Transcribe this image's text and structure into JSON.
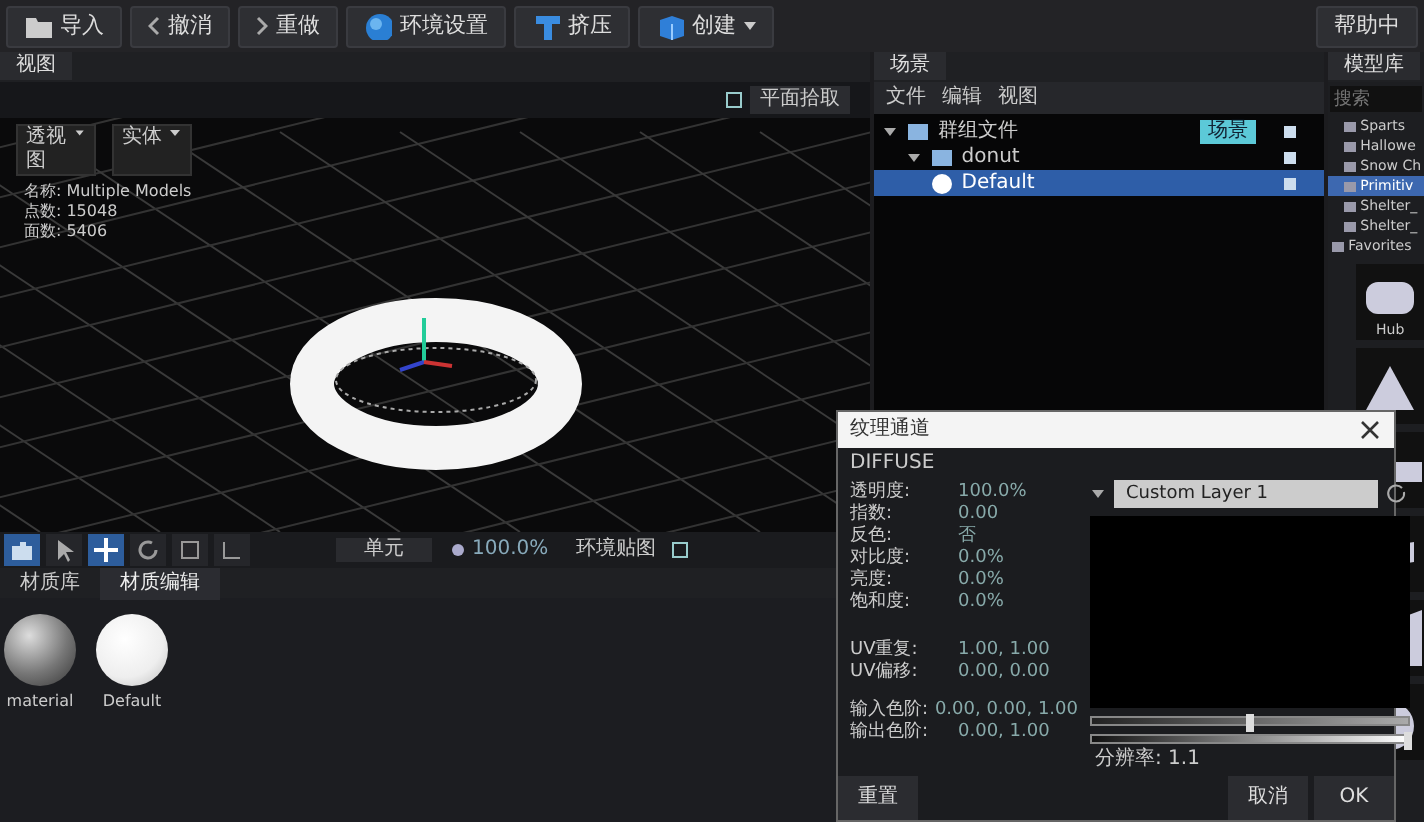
{
  "toolbar": {
    "buttons": [
      {
        "kind": "folder",
        "label": "导入"
      },
      {
        "kind": "undo",
        "label": "撤消"
      },
      {
        "kind": "redo",
        "label": "重做"
      },
      {
        "kind": "globe",
        "label": "环境设置"
      },
      {
        "kind": "extrude",
        "label": "挤压"
      },
      {
        "kind": "cube",
        "label": "创建",
        "menu": true
      }
    ],
    "help": "帮助中"
  },
  "viewport": {
    "tab": "视图",
    "pick": {
      "label": "平面拾取",
      "checked": false
    },
    "dropdowns": [
      "透视图",
      "实体"
    ],
    "info": [
      {
        "label": "名称:",
        "value": "Multiple Models"
      },
      {
        "label": "点数:",
        "value": "15048"
      },
      {
        "label": "面数:",
        "value": "5406"
      }
    ]
  },
  "view_toolbar": {
    "tools": [
      {
        "kind": "camera",
        "selected": true
      },
      {
        "kind": "pointer",
        "selected": false
      },
      {
        "kind": "move",
        "selected": true
      },
      {
        "kind": "rotate",
        "selected": false
      },
      {
        "kind": "scale",
        "selected": false
      },
      {
        "kind": "snap",
        "selected": false
      }
    ],
    "unit": "单元",
    "zoom": "100.0%",
    "env": "环境贴图",
    "env_checked": false
  },
  "material_panel": {
    "tabs": [
      {
        "label": "材质库",
        "selected": false
      },
      {
        "label": "材质编辑",
        "selected": true
      }
    ],
    "materials": [
      {
        "name": "material",
        "kind": "grey"
      },
      {
        "name": "Default",
        "kind": "white"
      }
    ]
  },
  "scene": {
    "title": "场景",
    "menu": [
      "文件",
      "编辑",
      "视图"
    ],
    "tree": [
      {
        "label": "群组文件",
        "badge": "场景",
        "expanded": true,
        "selected": false,
        "children": [
          {
            "label": "donut",
            "expanded": true,
            "selected": false,
            "children": [
              {
                "label": "Default",
                "selected": true
              }
            ]
          }
        ]
      }
    ]
  },
  "library": {
    "title": "模型库",
    "search": {
      "placeholder": "搜索"
    },
    "folders": [
      {
        "label": "Sparts",
        "selected": false
      },
      {
        "label": "Hallowe",
        "selected": false
      },
      {
        "label": "Snow Ch",
        "selected": false
      },
      {
        "label": "Primitiv",
        "selected": true
      },
      {
        "label": "Shelter_",
        "selected": false
      },
      {
        "label": "Shelter_",
        "selected": false
      }
    ],
    "favorites": "Favorites",
    "thumbnails": [
      {
        "kind": "blob",
        "label": "Hub"
      },
      {
        "kind": "cone"
      },
      {
        "kind": "bar"
      },
      {
        "kind": "slab"
      },
      {
        "kind": "wedge"
      },
      {
        "kind": "sphere"
      }
    ]
  },
  "dialog": {
    "title": "纹理通道",
    "channel": "DIFFUSE",
    "params": [
      {
        "label": "透明度:",
        "value": "100.0%"
      },
      {
        "label": "指数:",
        "value": "0.00"
      },
      {
        "label": "反色:",
        "value": "否"
      },
      {
        "label": "对比度:",
        "value": "0.0%"
      },
      {
        "label": "亮度:",
        "value": "0.0%"
      },
      {
        "label": "饱和度:",
        "value": "0.0%"
      }
    ],
    "uv": [
      {
        "label": "UV重复:",
        "value": "1.00, 1.00"
      },
      {
        "label": "UV偏移:",
        "value": "0.00, 0.00"
      }
    ],
    "levels": [
      {
        "label": "输入色阶:",
        "value": "0.00, 0.00, 1.00"
      },
      {
        "label": "输出色阶:",
        "value": "0.00, 1.00"
      }
    ],
    "layer": "Custom Layer 1",
    "sliders": [
      {
        "level": 0.5
      },
      {
        "level": 1
      }
    ],
    "resolution": "分辨率: 1.1",
    "buttons": {
      "reset": "重置",
      "cancel": "取消",
      "ok": "OK"
    }
  }
}
